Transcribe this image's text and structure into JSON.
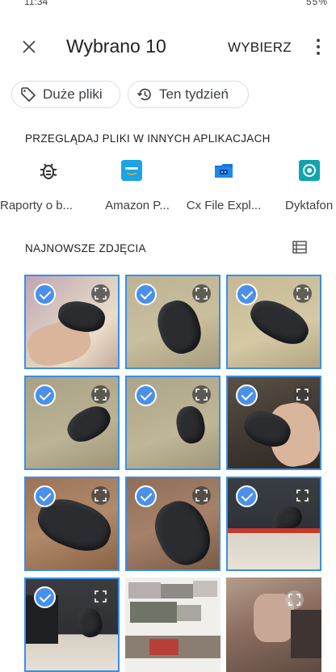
{
  "status_bar": {
    "time": "11:34",
    "right": "55%"
  },
  "header": {
    "title": "Wybrano 10",
    "select_label": "WYBIERZ",
    "close_icon": "close-icon",
    "more_icon": "more-vert-icon"
  },
  "chips": [
    {
      "label": "Duże pliki",
      "icon": "tag-icon"
    },
    {
      "label": "Ten tydzień",
      "icon": "history-icon"
    }
  ],
  "apps_section": {
    "title": "PRZEGLĄDAJ PLIKI W INNYCH APLIKACJACH",
    "apps": [
      {
        "label": "Raporty o b...",
        "icon": "bug-report-icon"
      },
      {
        "label": "Amazon P...",
        "icon": "amazon-photos-icon"
      },
      {
        "label": "Cx File Expl...",
        "icon": "cx-file-explorer-icon"
      },
      {
        "label": "Dyktafon",
        "icon": "recorder-icon"
      }
    ]
  },
  "photos_section": {
    "title": "NAJNOWSZE ZDJĘCIA",
    "list_icon": "list-view-icon",
    "photos": [
      {
        "selected": true
      },
      {
        "selected": true
      },
      {
        "selected": true
      },
      {
        "selected": true
      },
      {
        "selected": true
      },
      {
        "selected": true
      },
      {
        "selected": true
      },
      {
        "selected": true
      },
      {
        "selected": true
      },
      {
        "selected": true
      },
      {
        "selected": false
      },
      {
        "selected": false
      }
    ]
  },
  "colors": {
    "accent": "#4a90e8",
    "selection_border": "#3b8fe6",
    "recorder_teal": "#12a3b0",
    "amazon_blue": "#1ba3e6"
  }
}
